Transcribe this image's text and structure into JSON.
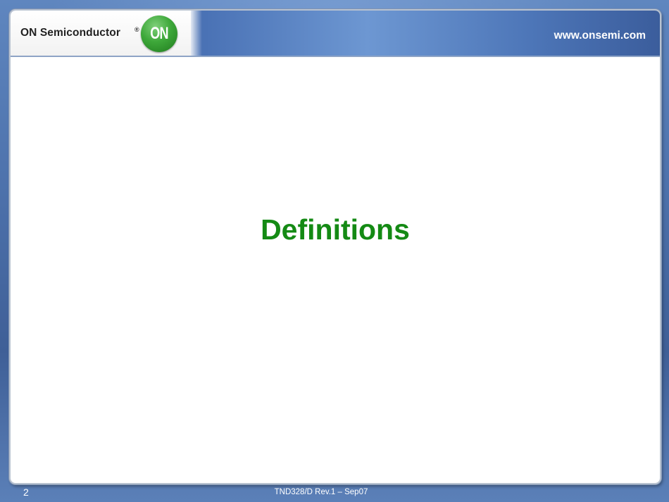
{
  "header": {
    "company_name": "ON Semiconductor",
    "registered_mark": "®",
    "logo_text": "ON",
    "website": "www.onsemi.com"
  },
  "main": {
    "title": "Definitions"
  },
  "footer": {
    "page_number": "2",
    "document_id": "TND328/D Rev.1 – Sep07"
  },
  "colors": {
    "title": "#148a14",
    "logo_green": "#3ea83a",
    "background_blue": "#4e73ad"
  }
}
